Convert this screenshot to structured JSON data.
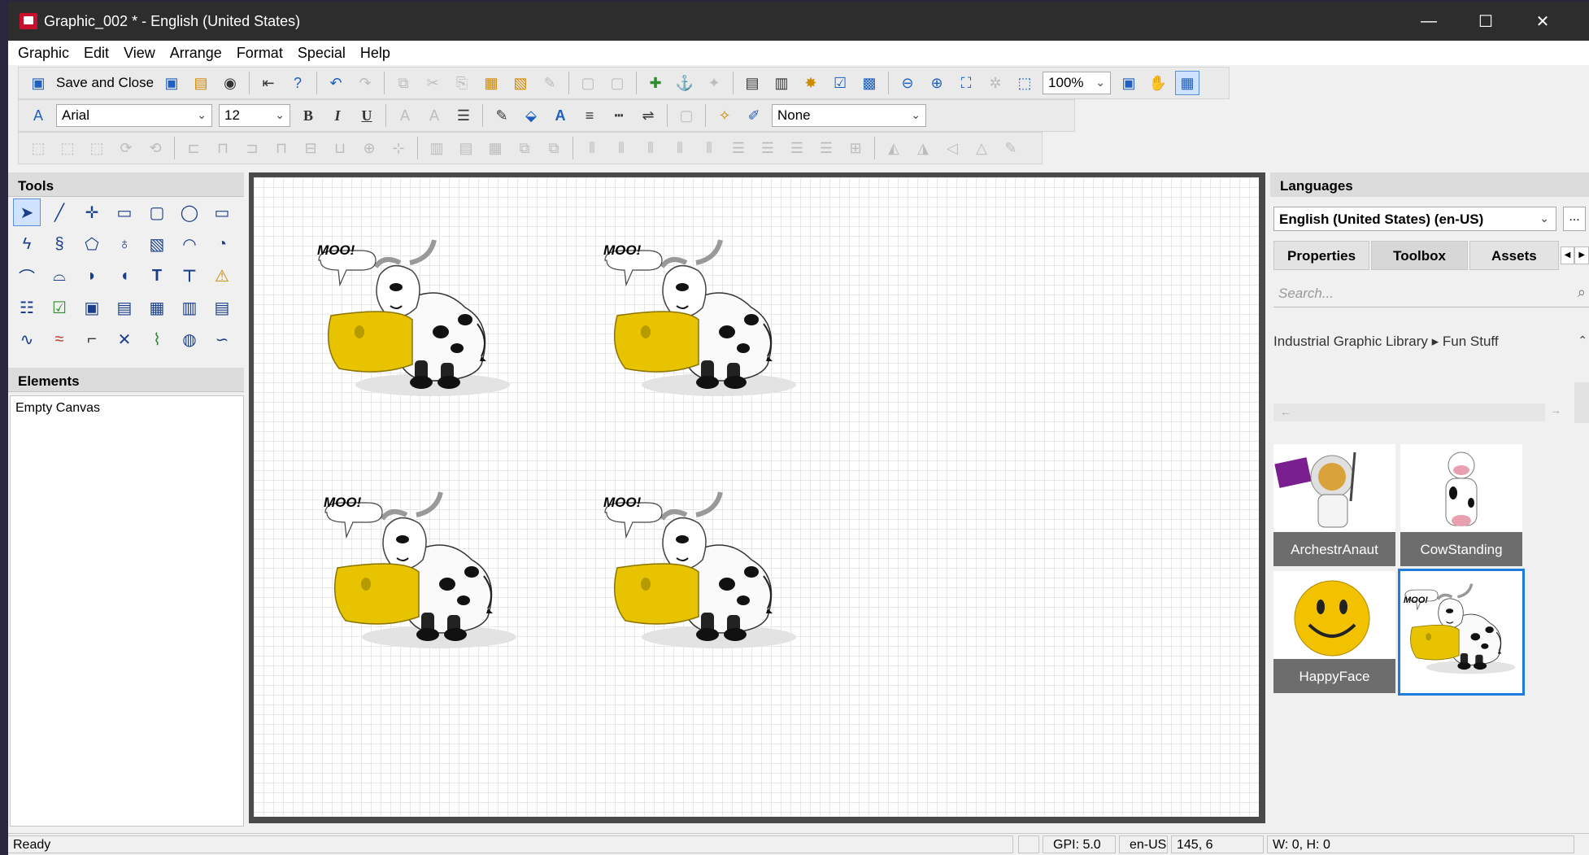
{
  "window": {
    "title": "Graphic_002 * - English (United States)",
    "minimize": "—",
    "maximize": "☐",
    "close": "✕"
  },
  "menu": [
    "Graphic",
    "Edit",
    "View",
    "Arrange",
    "Format",
    "Special",
    "Help"
  ],
  "toolbar1": {
    "save_close_label": "Save and Close",
    "zoom": "100%"
  },
  "toolbar2": {
    "font": "Arial",
    "size": "12",
    "bold": "B",
    "italic": "I",
    "underline": "U",
    "style_none": "None"
  },
  "tools_panel": {
    "title": "Tools"
  },
  "elements_panel": {
    "title": "Elements",
    "items": [
      "Empty Canvas"
    ]
  },
  "canvas": {
    "bubble_text": "MOO!"
  },
  "right_panel": {
    "languages_title": "Languages",
    "language": "English (United States) (en-US)",
    "more": "...",
    "tabs": [
      "Properties",
      "Toolbox",
      "Assets"
    ],
    "active_tab": "Toolbox",
    "search_placeholder": "Search...",
    "breadcrumb": "Industrial Graphic Library ▸ Fun Stuff",
    "assets": [
      "ArchestrAnaut",
      "CowStanding",
      "HappyFace",
      ""
    ]
  },
  "status": {
    "ready": "Ready",
    "gpi": "GPI: 5.0",
    "locale": "en-US",
    "coords": "145, 6",
    "size": "W: 0, H: 0"
  },
  "colors": {
    "titlebar": "#2d2d2d",
    "selection": "#1e7be0",
    "cow_yellow": "#e8c400"
  }
}
